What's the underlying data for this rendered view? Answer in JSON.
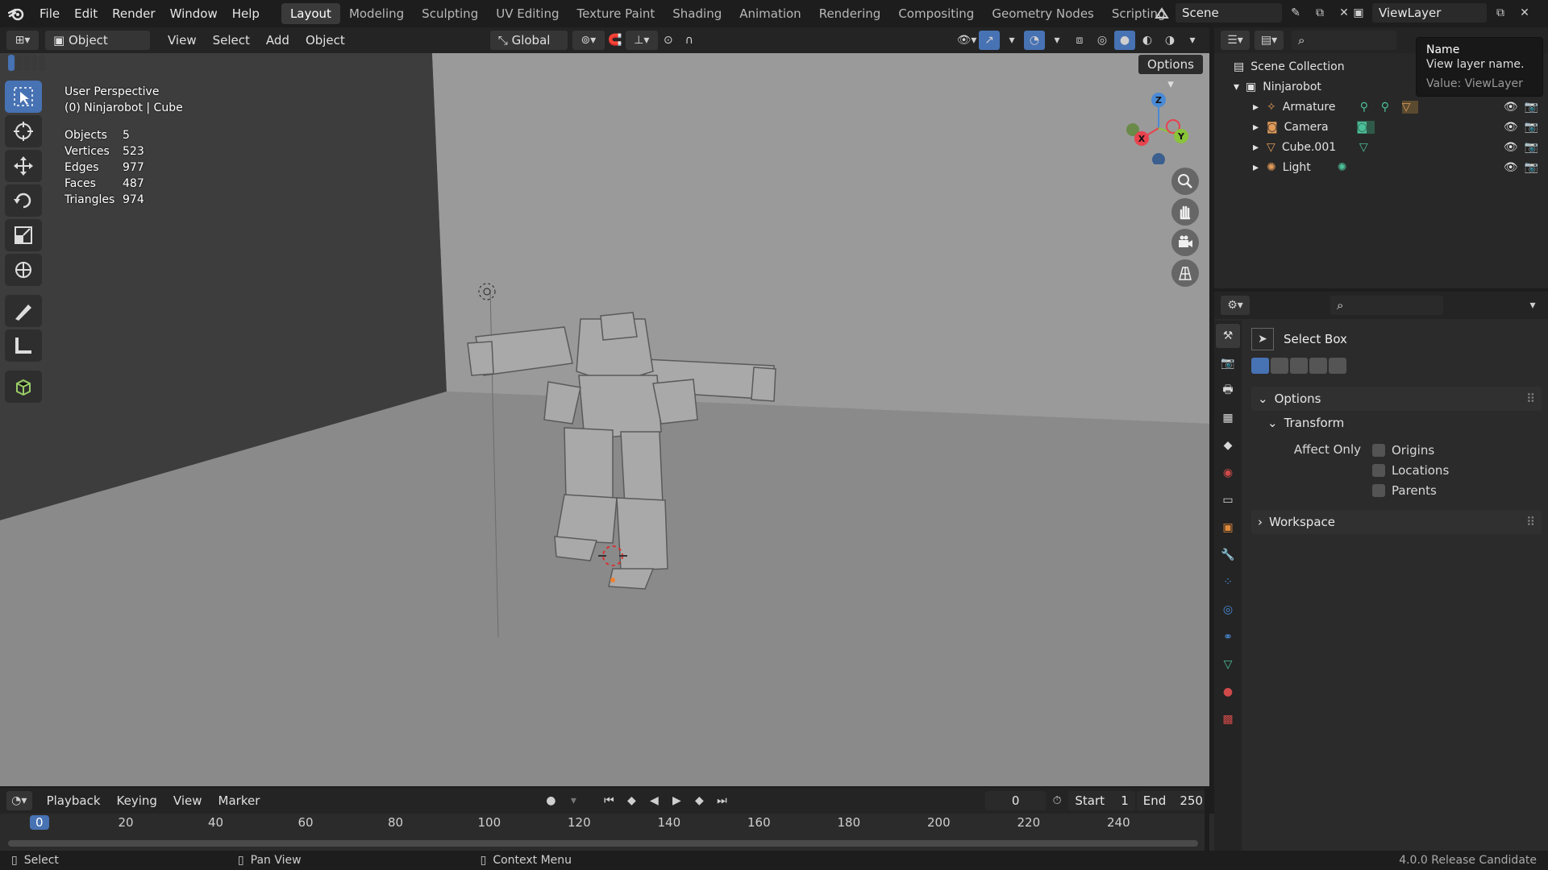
{
  "topbar": {
    "menus": [
      "File",
      "Edit",
      "Render",
      "Window",
      "Help"
    ],
    "workspaces": [
      "Layout",
      "Modeling",
      "Sculpting",
      "UV Editing",
      "Texture Paint",
      "Shading",
      "Animation",
      "Rendering",
      "Compositing",
      "Geometry Nodes",
      "Scripting"
    ],
    "active_workspace": "Layout",
    "scene": "Scene",
    "view_layer": "ViewLayer"
  },
  "viewport_header": {
    "mode": "Object Mode",
    "menus": [
      "View",
      "Select",
      "Add",
      "Object"
    ],
    "orientation": "Global",
    "options": "Options"
  },
  "viewport": {
    "perspective": "User Perspective",
    "context": "(0) Ninjarobot | Cube",
    "stats": [
      {
        "label": "Objects",
        "value": "5"
      },
      {
        "label": "Vertices",
        "value": "523"
      },
      {
        "label": "Edges",
        "value": "977"
      },
      {
        "label": "Faces",
        "value": "487"
      },
      {
        "label": "Triangles",
        "value": "974"
      }
    ],
    "gizmo": {
      "x": "X",
      "y": "Y",
      "z": "Z"
    }
  },
  "tooltip": {
    "title": "Name",
    "desc": "View layer name.",
    "value": "Value: ViewLayer"
  },
  "outliner": {
    "root": "Scene Collection",
    "collection": "Ninjarobot",
    "items": [
      "Armature",
      "Camera",
      "Cube.001",
      "Light"
    ]
  },
  "properties": {
    "tool_name": "Select Box",
    "options": "Options",
    "transform": "Transform",
    "affect_only": "Affect Only",
    "checks": [
      "Origins",
      "Locations",
      "Parents"
    ],
    "workspace": "Workspace"
  },
  "timeline": {
    "menus": [
      "Playback",
      "Keying",
      "View",
      "Marker"
    ],
    "current_frame": "0",
    "start_label": "Start",
    "start": "1",
    "end_label": "End",
    "end": "250",
    "ticks": [
      "0",
      "20",
      "40",
      "60",
      "80",
      "100",
      "120",
      "140",
      "160",
      "180",
      "200",
      "220",
      "240"
    ]
  },
  "statusbar": {
    "hints": [
      "Select",
      "Pan View",
      "Context Menu"
    ],
    "version": "4.0.0 Release Candidate"
  },
  "colors": {
    "accent": "#4772b3",
    "x_axis": "#e8424d",
    "y_axis": "#8ac43a",
    "z_axis": "#4a8ad6"
  }
}
